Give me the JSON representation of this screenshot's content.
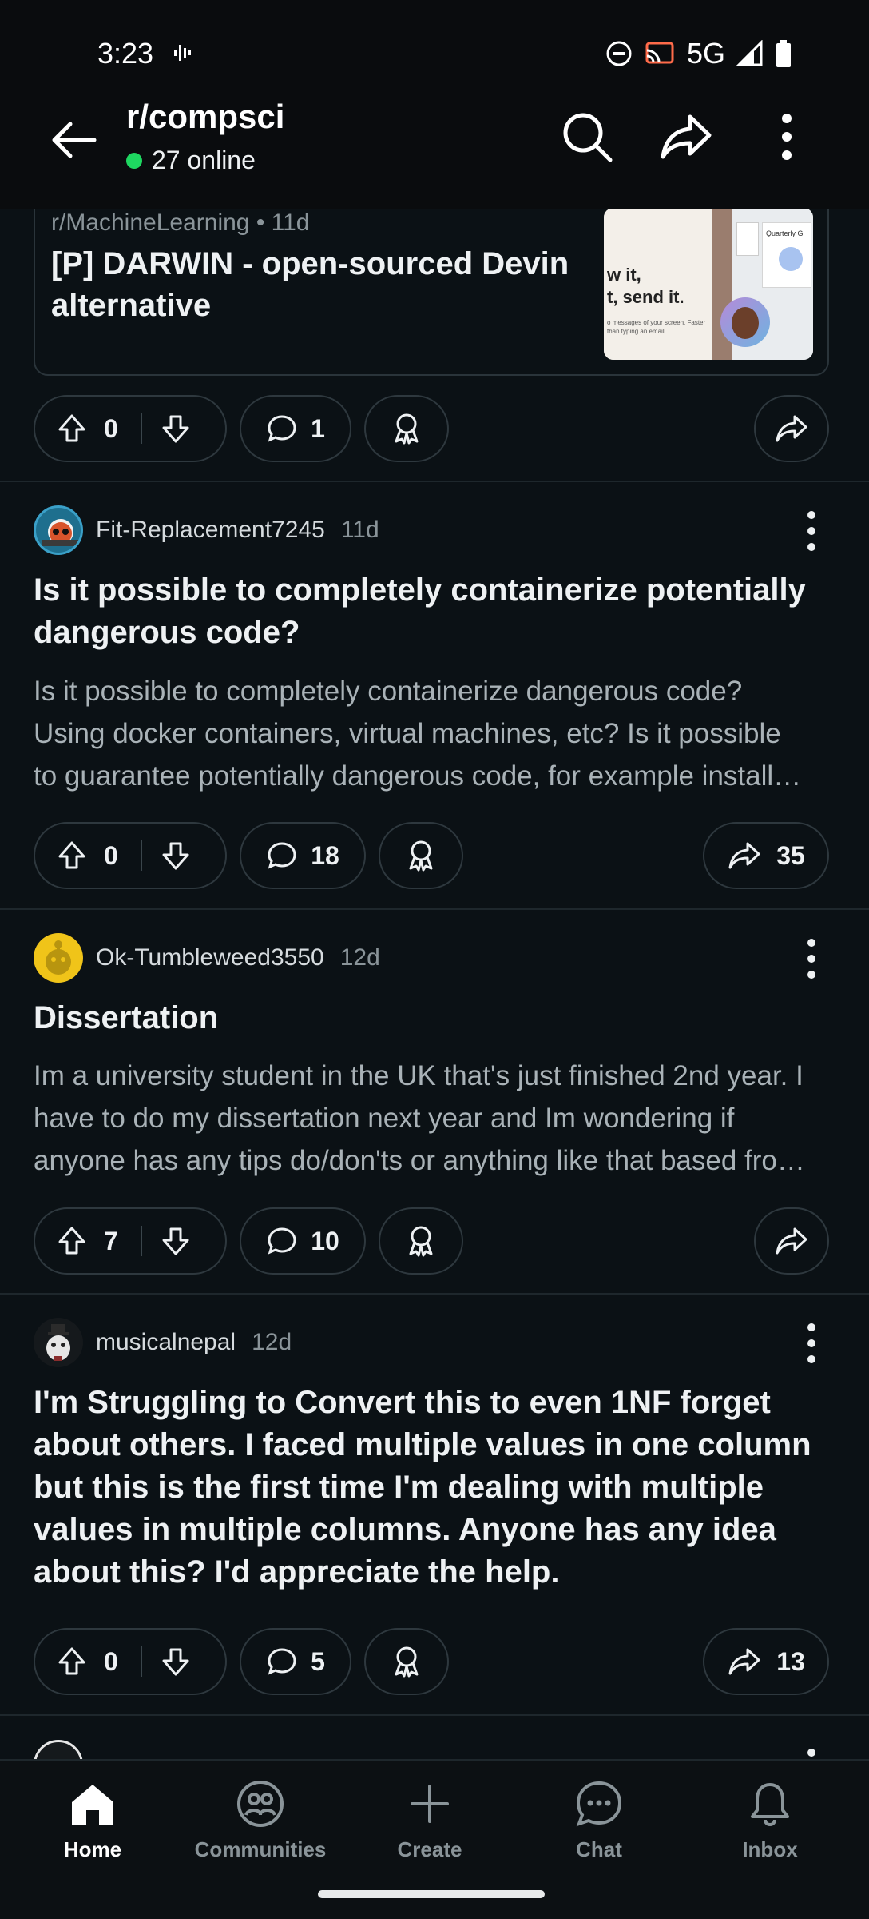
{
  "status_bar": {
    "time": "3:23",
    "network": "5G"
  },
  "header": {
    "subreddit": "r/compsci",
    "online": "27 online"
  },
  "crosspost": {
    "meta": "r/MachineLearning • 11d",
    "title": "[P] DARWIN - open-sourced Devin alternative",
    "thumb_text_line1": "w it,",
    "thumb_text_line2": "t, send it.",
    "thumb_small": "o messages of your screen. Faster than typing an email",
    "thumb_label": "Quarterly G"
  },
  "crosspost_actions": {
    "upvotes": "0",
    "comments": "1"
  },
  "posts": [
    {
      "author": "Fit-Replacement7245",
      "age": "11d",
      "title": "Is it possible to completely containerize potentially dangerous code?",
      "body": [
        "Is it possible to completely containerize dangerous code?",
        "Using docker containers, virtual machines, etc? Is it possible",
        "to guarantee potentially dangerous code, for example install…"
      ],
      "upvotes": "0",
      "comments": "18",
      "shares": "35"
    },
    {
      "author": "Ok-Tumbleweed3550",
      "age": "12d",
      "title": "Dissertation",
      "body": [
        "Im a university student in the UK that's just finished 2nd year. I",
        "have to do my dissertation next year and Im wondering if",
        "anyone has any tips do/don'ts or anything like that based fro…"
      ],
      "upvotes": "7",
      "comments": "10",
      "shares": ""
    },
    {
      "author": "musicalnepal",
      "age": "12d",
      "title": "I'm Struggling to Convert this to even 1NF forget about others. I faced multiple values in one column but this is the first time I'm dealing with multiple values in multiple columns. Anyone has any idea about this? I'd appreciate the help.",
      "body": [],
      "upvotes": "0",
      "comments": "5",
      "shares": "13"
    }
  ],
  "bottom_nav": [
    {
      "label": "Home",
      "icon": "home-icon"
    },
    {
      "label": "Communities",
      "icon": "communities-icon"
    },
    {
      "label": "Create",
      "icon": "plus-icon"
    },
    {
      "label": "Chat",
      "icon": "chat-icon"
    },
    {
      "label": "Inbox",
      "icon": "bell-icon"
    }
  ],
  "colors": {
    "background": "#0b1115",
    "online_dot": "#1ed760",
    "muted_text": "#8a9499"
  }
}
